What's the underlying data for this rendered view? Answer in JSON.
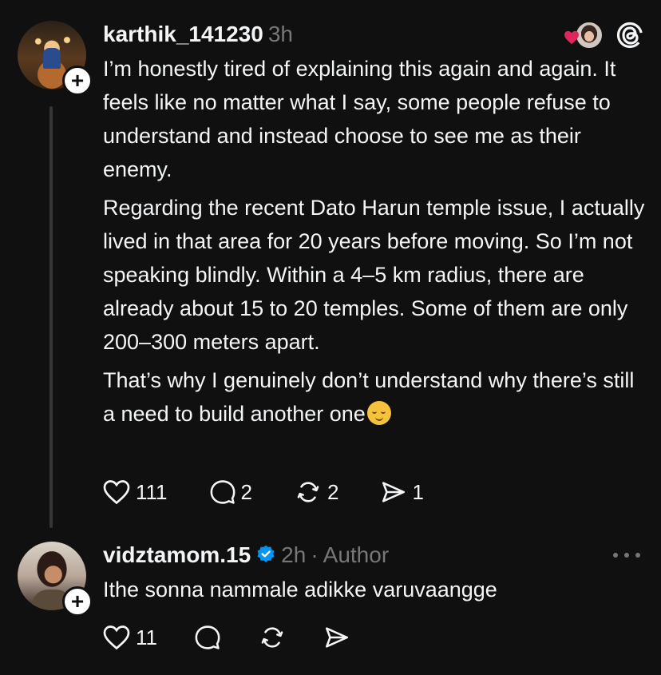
{
  "post": {
    "username": "karthik_141230",
    "time": "3h",
    "paragraphs": [
      "I’m honestly tired of explaining this again and again. It feels like no matter what I say, some people refuse to understand and instead choose to see me as their enemy.",
      "Regarding the recent Dato Harun temple issue, I actually lived in that area for 20 years before moving. So I’m not speaking blindly. Within a 4–5 km radius, there are already about 15 to 20 temples. Some of them are only 200–300 meters apart.",
      "That’s why I genuinely don’t understand why there’s still a need to build another one"
    ],
    "emoji": "relieved-face-emoji",
    "counts": {
      "likes": "111",
      "replies": "2",
      "reposts": "2",
      "shares": "1"
    }
  },
  "reply": {
    "username": "vidztamom.15",
    "time": "2h",
    "separator": "·",
    "author_label": "Author",
    "text": "Ithe sonna nammale adikke varuvaangge",
    "counts": {
      "likes": "11"
    }
  },
  "icons": {
    "follow": "+",
    "heart_liked_color": "#e0245e",
    "verified_color": "#0095f6"
  },
  "colors": {
    "background": "#101010",
    "text": "#f3f5f7",
    "muted": "#777777"
  }
}
